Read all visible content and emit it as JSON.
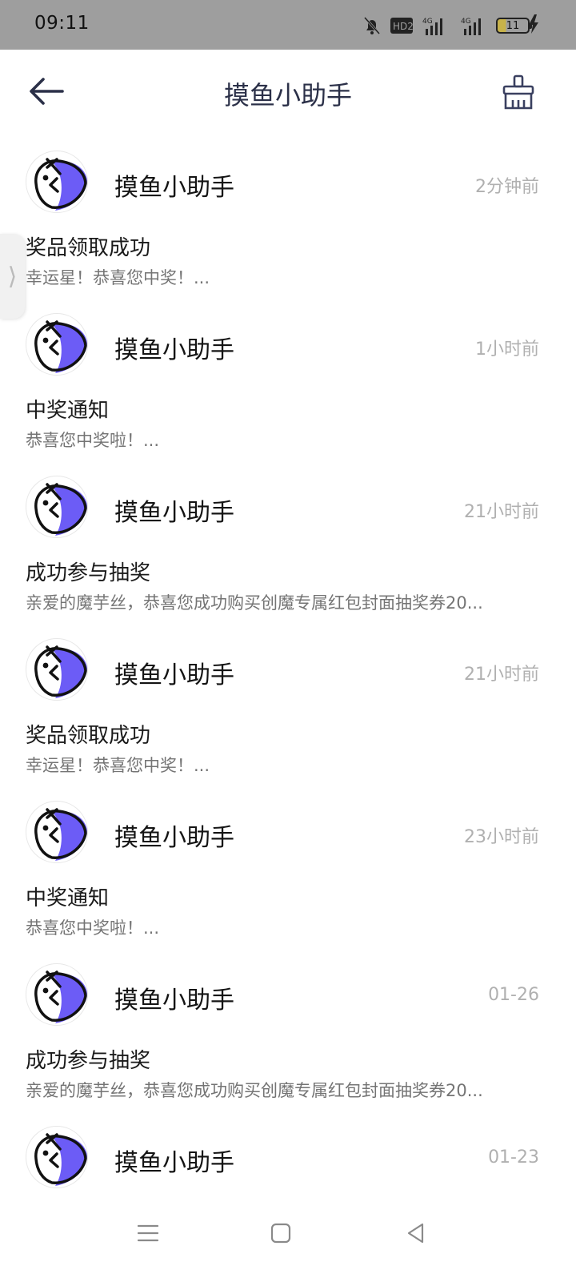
{
  "status_bar": {
    "time": "09:11",
    "hd_label": "HD2",
    "network_1": "4G",
    "network_2": "4G",
    "battery_level": "11"
  },
  "header": {
    "title": "摸鱼小助手",
    "back_icon": "back-arrow-icon",
    "clean_icon": "broom-icon"
  },
  "side_tab": {
    "icon": "chevron-right-icon",
    "glyph": "⟩"
  },
  "messages": [
    {
      "sender": "摸鱼小助手",
      "time": "2分钟前",
      "title": "奖品领取成功",
      "preview": "幸运星！恭喜您中奖！..."
    },
    {
      "sender": "摸鱼小助手",
      "time": "1小时前",
      "title": "中奖通知",
      "preview": "恭喜您中奖啦！..."
    },
    {
      "sender": "摸鱼小助手",
      "time": "21小时前",
      "title": "成功参与抽奖",
      "preview": "亲爱的魔芋丝，恭喜您成功购买创魔专属红包封面抽奖券20..."
    },
    {
      "sender": "摸鱼小助手",
      "time": "21小时前",
      "title": "奖品领取成功",
      "preview": "幸运星！恭喜您中奖！..."
    },
    {
      "sender": "摸鱼小助手",
      "time": "23小时前",
      "title": "中奖通知",
      "preview": "恭喜您中奖啦！..."
    },
    {
      "sender": "摸鱼小助手",
      "time": "01-26",
      "title": "成功参与抽奖",
      "preview": "亲爱的魔芋丝，恭喜您成功购买创魔专属红包封面抽奖券20..."
    },
    {
      "sender": "摸鱼小助手",
      "time": "01-23",
      "title": "",
      "preview": ""
    }
  ],
  "nav_bar": {
    "menu_icon": "menu-icon",
    "home_icon": "home-square-icon",
    "back_icon": "back-triangle-icon"
  },
  "colors": {
    "status_bar_bg": "#9e9e9e",
    "title_text": "#2b3048",
    "avatar_accent": "#6c5cf6",
    "time_text": "#b0b0b0",
    "preview_text": "#747474"
  }
}
